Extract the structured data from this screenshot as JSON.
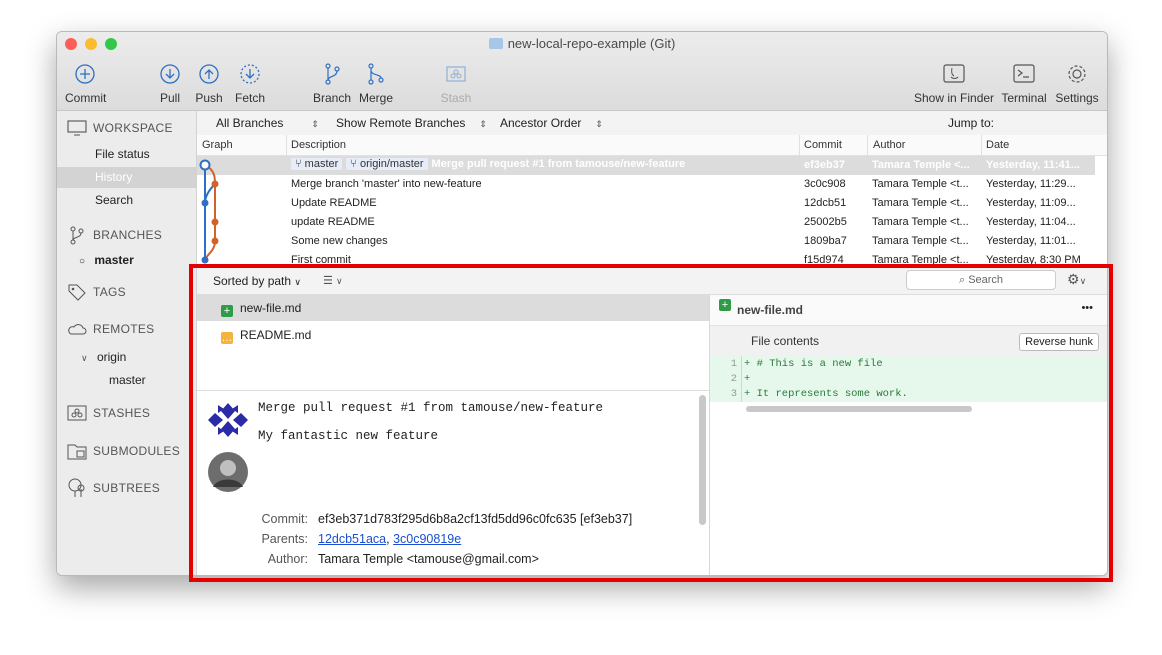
{
  "window": {
    "title": "new-local-repo-example (Git)",
    "traffic_lights": [
      "#fc5f57",
      "#fdbc2e",
      "#34c84a"
    ]
  },
  "toolbar": {
    "commit": "Commit",
    "pull": "Pull",
    "push": "Push",
    "fetch": "Fetch",
    "branch": "Branch",
    "merge": "Merge",
    "stash": "Stash",
    "show_in_finder": "Show in Finder",
    "terminal": "Terminal",
    "settings": "Settings"
  },
  "sidebar": {
    "workspace": "WORKSPACE",
    "file_status": "File status",
    "history": "History",
    "search": "Search",
    "branches": "BRANCHES",
    "master": "master",
    "tags": "TAGS",
    "remotes": "REMOTES",
    "origin": "origin",
    "origin_master": "master",
    "stashes": "STASHES",
    "submodules": "SUBMODULES",
    "subtrees": "SUBTREES"
  },
  "filters": {
    "branches": "All Branches",
    "remote": "Show Remote Branches",
    "order": "Ancestor Order",
    "jump": "Jump to:"
  },
  "columns": {
    "graph": "Graph",
    "description": "Description",
    "commit": "Commit",
    "author": "Author",
    "date": "Date"
  },
  "commits": [
    {
      "tag1": "master",
      "tag2": "origin/master",
      "description": "Merge pull request #1 from tamouse/new-feature",
      "hash": "ef3eb37",
      "author": "Tamara Temple <...",
      "date": "Yesterday, 11:41..."
    },
    {
      "description": "Merge branch 'master' into new-feature",
      "hash": "3c0c908",
      "author": "Tamara Temple <t...",
      "date": "Yesterday, 11:29..."
    },
    {
      "description": "Update README",
      "hash": "12dcb51",
      "author": "Tamara Temple <t...",
      "date": "Yesterday, 11:09..."
    },
    {
      "description": "update README",
      "hash": "25002b5",
      "author": "Tamara Temple <t...",
      "date": "Yesterday, 11:04..."
    },
    {
      "description": "Some new changes",
      "hash": "1809ba7",
      "author": "Tamara Temple <t...",
      "date": "Yesterday, 11:01..."
    },
    {
      "description": "First commit",
      "hash": "f15d974",
      "author": "Tamara Temple <t...",
      "date": "Yesterday, 8:30 PM"
    }
  ],
  "lower": {
    "sort": "Sorted by path",
    "search_placeholder": "Search",
    "files": [
      "new-file.md",
      "README.md"
    ],
    "commit_subject": "Merge pull request #1 from tamouse/new-feature",
    "commit_body": "My fantastic new feature",
    "commit_label": "Commit:",
    "commit_value": "ef3eb371d783f295d6b8a2cf13fd5dd96c0fc635 [ef3eb37]",
    "parents_label": "Parents:",
    "parent1": "12dcb51aca",
    "parent2": "3c0c90819e",
    "author_label": "Author:",
    "author_value": "Tamara Temple <tamouse@gmail.com>"
  },
  "diff": {
    "file": "new-file.md",
    "more": "•••",
    "section": "File contents",
    "reverse": "Reverse hunk",
    "lines": [
      {
        "n": "1",
        "t": "+ # This is a new file"
      },
      {
        "n": "2",
        "t": "+"
      },
      {
        "n": "3",
        "t": "+ It represents some work."
      }
    ]
  },
  "colors": {
    "accent_blue": "#2f6fc4",
    "branch_orange": "#d0622a",
    "highlight_red": "#e40000",
    "added_bg": "#e6f7ec"
  }
}
